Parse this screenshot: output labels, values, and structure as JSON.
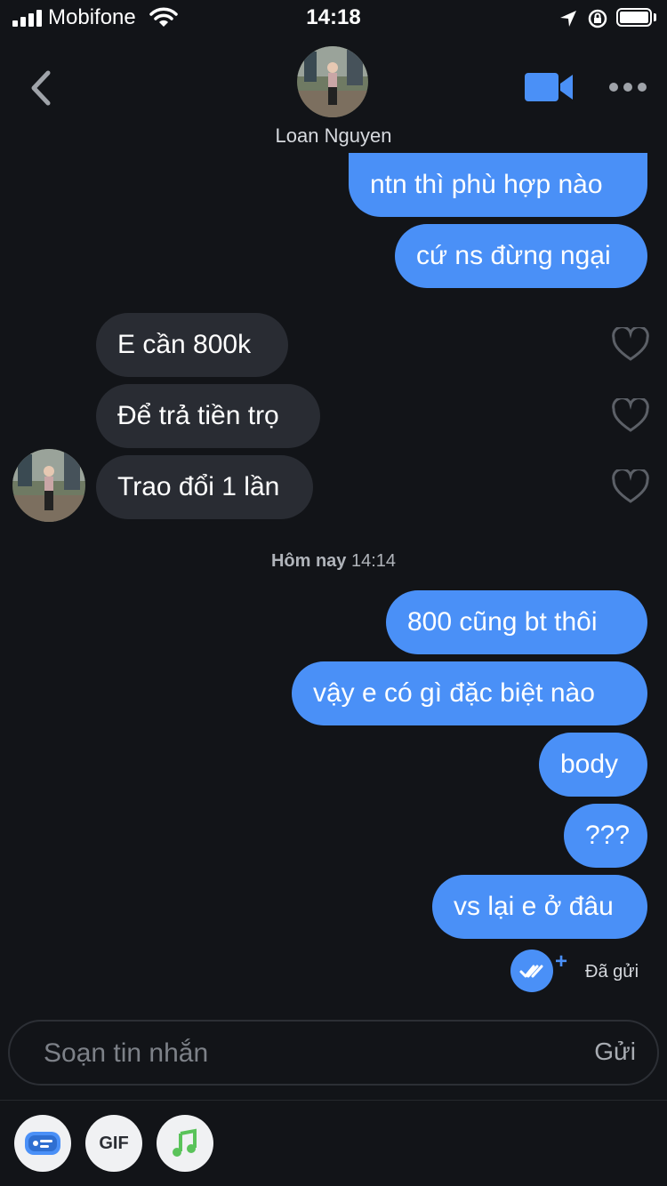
{
  "status_bar": {
    "carrier": "Mobifone",
    "time": "14:18"
  },
  "header": {
    "contact_name": "Loan Nguyen"
  },
  "messages": {
    "m1": "ntn thì phù hợp nào",
    "m2": "cứ ns đừng ngại",
    "m3": "E cần 800k",
    "m4": "Để trả tiền trọ",
    "m5": "Trao đổi 1 lần",
    "divider_bold": "Hôm nay",
    "divider_time": "14:14",
    "m6": "800 cũng bt thôi",
    "m7": "vậy e có gì đặc biệt nào",
    "m8": "body",
    "m9": "???",
    "m10": "vs lại e ở đâu",
    "sent_status": "Đã gửi"
  },
  "composer": {
    "placeholder": "Soạn tin nhắn",
    "send_label": "Gửi"
  },
  "toolbar": {
    "gif_label": "GIF"
  },
  "colors": {
    "accent": "#4a90f7",
    "background": "#121418",
    "incoming_bubble": "#292c33",
    "music_green": "#5ac35a"
  }
}
